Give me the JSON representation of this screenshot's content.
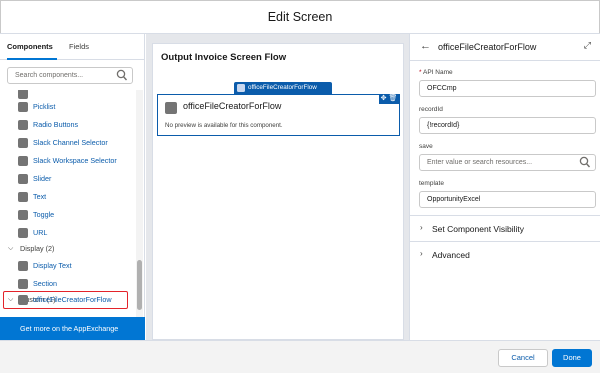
{
  "dialog": {
    "title": "Edit Screen"
  },
  "left_panel": {
    "tabs": [
      "Components",
      "Fields"
    ],
    "search_placeholder": "Search components...",
    "items": [
      {
        "label": "Picklist"
      },
      {
        "label": "Radio Buttons"
      },
      {
        "label": "Slack Channel Selector"
      },
      {
        "label": "Slack Workspace Selector"
      },
      {
        "label": "Slider"
      },
      {
        "label": "Text"
      },
      {
        "label": "Toggle"
      },
      {
        "label": "URL"
      }
    ],
    "sections": [
      {
        "label": "Display (2)",
        "items": [
          "Display Text",
          "Section"
        ]
      },
      {
        "label": "Custom (1)",
        "items": [
          "officeFileCreatorForFlow"
        ]
      }
    ],
    "appexchange_label": "Get more on the AppExchange"
  },
  "canvas": {
    "flow_title": "Output Invoice Screen Flow",
    "component_label": "officeFileCreatorForFlow",
    "component_name": "officeFileCreatorForFlow",
    "component_preview": "No preview is available for this component.",
    "tools_glyph": "✥ 🗑"
  },
  "properties": {
    "title": "officeFileCreatorForFlow",
    "fields": [
      {
        "label": "API Name",
        "required": true,
        "value": "OFCCmp",
        "placeholder": ""
      },
      {
        "label": "recordId",
        "required": false,
        "value": "{!recordId}",
        "placeholder": ""
      },
      {
        "label": "save",
        "required": false,
        "value": "",
        "placeholder": "Enter value or search resources..."
      },
      {
        "label": "template",
        "required": false,
        "value": "OpportunityExcel",
        "placeholder": ""
      }
    ],
    "accordions": [
      "Set Component Visibility",
      "Advanced"
    ]
  },
  "footer": {
    "cancel_label": "Cancel",
    "done_label": "Done"
  },
  "colors": {
    "brand": "#0176d3",
    "selection": "#e3232a",
    "component_icon": "#747474"
  }
}
